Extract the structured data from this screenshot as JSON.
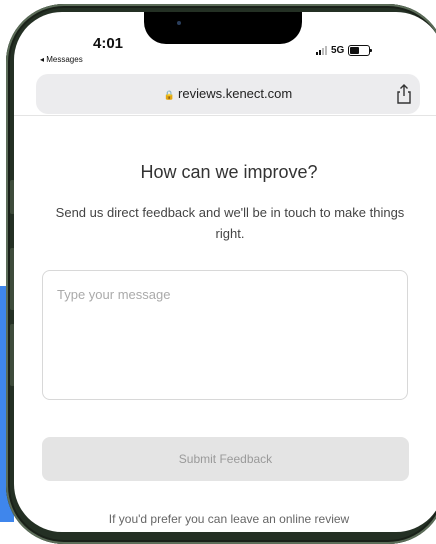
{
  "status_bar": {
    "time": "4:01",
    "back_label": "◂ Messages",
    "network": "5G"
  },
  "browser": {
    "url": "reviews.kenect.com"
  },
  "page": {
    "heading": "How can we improve?",
    "subtext": "Send us direct feedback and we'll be in touch to make things right.",
    "message_placeholder": "Type your message",
    "submit_label": "Submit Feedback",
    "footer_text": "If you'd prefer you can leave an online review"
  },
  "colors": {
    "accent_blue": "#3f86ec",
    "frame": "#243024"
  }
}
